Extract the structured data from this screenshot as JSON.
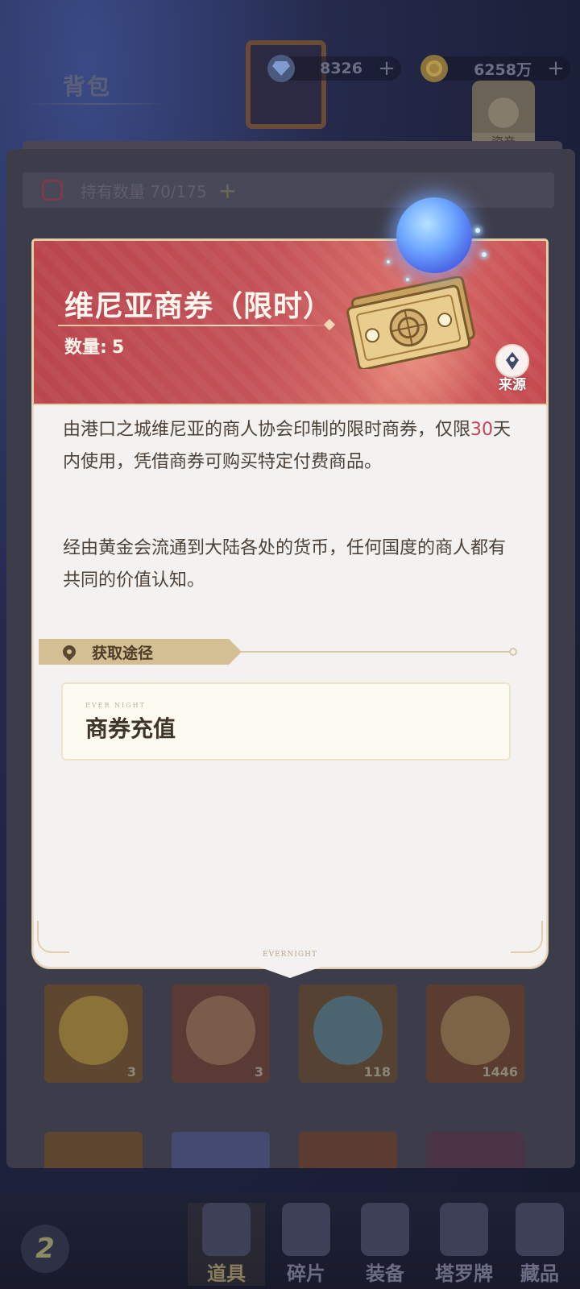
{
  "background": {
    "screen_title": "背包",
    "currencies": [
      {
        "icon": "gem-icon",
        "value": "8326"
      },
      {
        "icon": "gold-coin-icon",
        "value": "6258万"
      }
    ],
    "assets_label": "资产",
    "hold_count_label": "持有数量 70/175",
    "grid_counts": [
      "3",
      "3",
      "118",
      "1446"
    ],
    "nav": [
      {
        "label": "道具",
        "active": true
      },
      {
        "label": "碎片",
        "active": false
      },
      {
        "label": "装备",
        "active": false
      },
      {
        "label": "塔罗牌",
        "active": false
      },
      {
        "label": "藏品",
        "active": false
      }
    ]
  },
  "dialog": {
    "item_name": "维尼亚商券（限时）",
    "quantity_label": "数量:",
    "quantity_value": "5",
    "source_label": "来源",
    "description_p1_before": "由港口之城维尼亚的商人协会印制的限时商券，仅限",
    "description_p1_highlight": "30",
    "description_p1_after": "天内使用，凭借商券可购买特定付费商品。",
    "description_p2": "经由黄金会流通到大陆各处的货币，任何国度的商人都有共同的价值认知。",
    "acquire_header": "获取途径",
    "acquire_sources": [
      {
        "brand": "EVER NIGHT",
        "label": "商券充值"
      }
    ],
    "footer_brand": "EVERNIGHT"
  },
  "colors": {
    "header_red": "#c45359",
    "highlight_number": "#c4455a",
    "gold_accent": "#d4be93"
  }
}
